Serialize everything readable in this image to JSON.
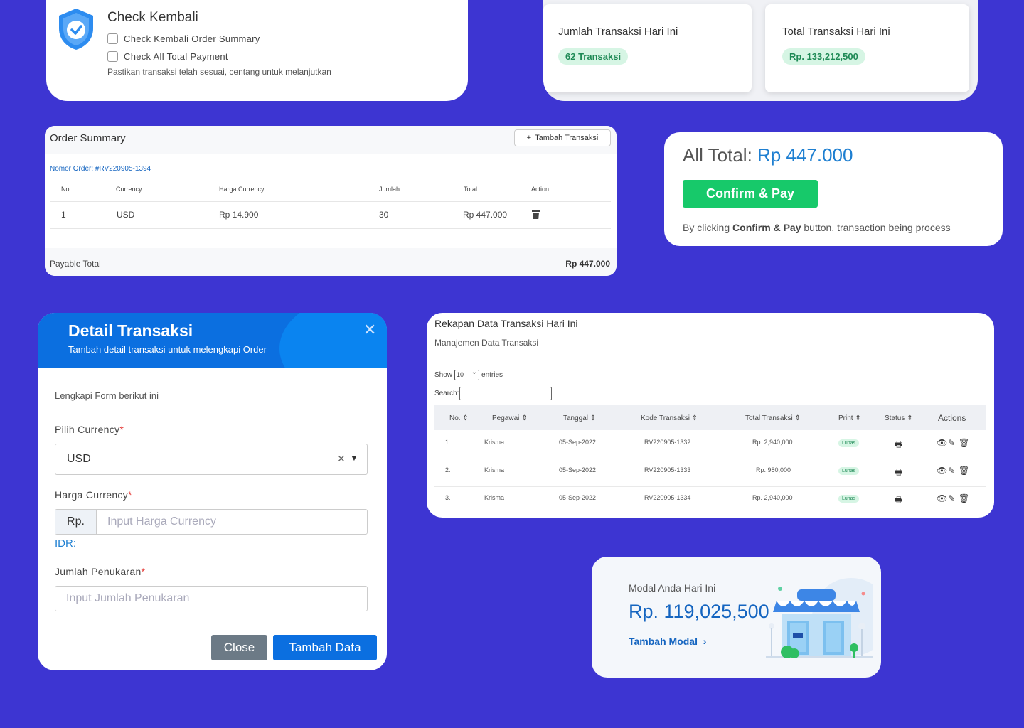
{
  "check": {
    "title": "Check Kembali",
    "items": [
      "Check Kembali Order Summary",
      "Check All Total Payment"
    ],
    "hint": "Pastikan transaksi telah sesuai, centang untuk melanjutkan"
  },
  "stats": {
    "count_label": "Jumlah Transaksi Hari Ini",
    "count_value": "62 Transaksi",
    "total_label": "Total Transaksi Hari Ini",
    "total_value": "Rp. 133,212,500"
  },
  "order": {
    "title": "Order Summary",
    "add_button": "Tambah Transaksi",
    "nomor": "Nomor Order: #RV220905-1394",
    "columns": [
      "No.",
      "Currency",
      "Harga Currency",
      "Jumlah",
      "Total",
      "Action"
    ],
    "rows": [
      {
        "no": "1",
        "currency": "USD",
        "harga": "Rp 14.900",
        "jumlah": "30",
        "total": "Rp 447.000"
      }
    ],
    "payable_label": "Payable Total",
    "payable_value": "Rp 447.000"
  },
  "all_total": {
    "label": "All Total:",
    "value": "Rp 447.000",
    "button": "Confirm & Pay",
    "note_prefix": "By clicking",
    "note_bold": "Confirm & Pay",
    "note_suffix": "button, transaction being process"
  },
  "detail": {
    "title": "Detail Transaksi",
    "subtitle": "Tambah detail transaksi untuk melengkapi Order",
    "intro": "Lengkapi Form berikut ini",
    "currency_label": "Pilih Currency",
    "currency_value": "USD",
    "harga_label": "Harga Currency",
    "harga_addon": "Rp.",
    "harga_placeholder": "Input Harga Currency",
    "idr_label": "IDR:",
    "jumlah_label": "Jumlah Penukaran",
    "jumlah_placeholder": "Input Jumlah Penukaran",
    "close_button": "Close",
    "add_button": "Tambah Data",
    "required_mark": "*"
  },
  "rekap": {
    "title": "Rekapan Data Transaksi Hari Ini",
    "subtitle": "Manajemen Data Transaksi",
    "show_label": "Show",
    "show_value": "10",
    "entries_label": "entries",
    "search_label": "Search:",
    "columns": [
      "No. ⇕",
      "Pegawai ⇕",
      "Tanggal ⇕",
      "Kode Transaksi ⇕",
      "Total Transaksi ⇕",
      "Print ⇕",
      "Status ⇕",
      "Actions"
    ],
    "rows": [
      {
        "no": "1.",
        "pegawai": "Krisma",
        "tanggal": "05-Sep-2022",
        "kode": "RV220905-1332",
        "total": "Rp. 2,940,000",
        "status": "Lunas"
      },
      {
        "no": "2.",
        "pegawai": "Krisma",
        "tanggal": "05-Sep-2022",
        "kode": "RV220905-1333",
        "total": "Rp. 980,000",
        "status": "Lunas"
      },
      {
        "no": "3.",
        "pegawai": "Krisma",
        "tanggal": "05-Sep-2022",
        "kode": "RV220905-1334",
        "total": "Rp. 2,940,000",
        "status": "Lunas"
      }
    ]
  },
  "modal": {
    "label": "Modal Anda Hari Ini",
    "value": "Rp. 119,025,500",
    "link": "Tambah Modal"
  },
  "icons": {
    "shield": "shield-check-icon",
    "plus": "plus-icon",
    "trash": "trash-icon",
    "close": "close-icon",
    "print": "printer-icon",
    "view": "eye-icon",
    "edit": "edit-icon",
    "chevron": "chevron-right-icon",
    "store": "store-illustration-icon"
  },
  "colors": {
    "background": "#3d35d2",
    "primary": "#0b6fe0",
    "success": "#17c96a",
    "badge_bg": "#d6f5e4",
    "badge_text": "#1f8a56"
  }
}
